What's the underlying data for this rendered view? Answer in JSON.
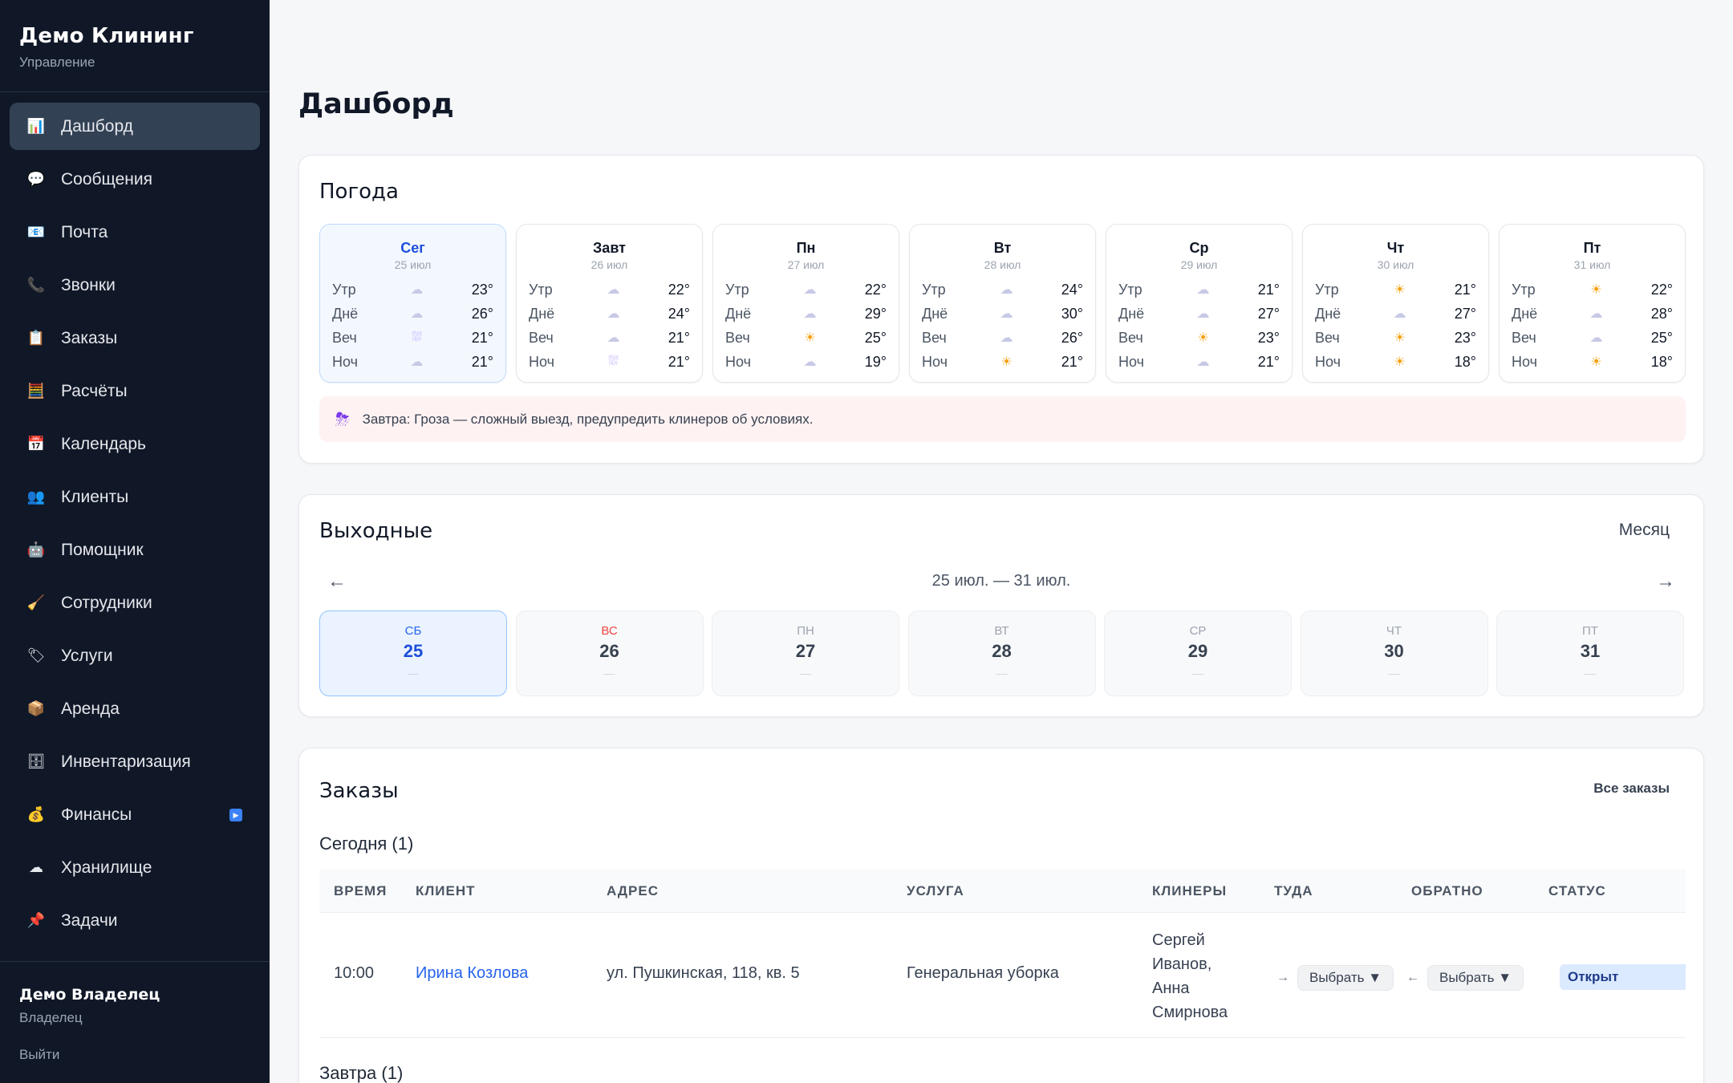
{
  "brand": {
    "title": "Демо Клининг",
    "subtitle": "Управление"
  },
  "nav": [
    {
      "label": "Дашборд",
      "icon": "📊",
      "active": true
    },
    {
      "label": "Сообщения",
      "icon": "💬"
    },
    {
      "label": "Почта",
      "icon": "📧"
    },
    {
      "label": "Звонки",
      "icon": "📞"
    },
    {
      "label": "Заказы",
      "icon": "📋"
    },
    {
      "label": "Расчёты",
      "icon": "🧮"
    },
    {
      "label": "Календарь",
      "icon": "📅"
    },
    {
      "label": "Клиенты",
      "icon": "👥"
    },
    {
      "label": "Помощник",
      "icon": "🤖"
    },
    {
      "label": "Сотрудники",
      "icon": "🧹"
    },
    {
      "label": "Услуги",
      "icon": "🏷"
    },
    {
      "label": "Аренда",
      "icon": "📦"
    },
    {
      "label": "Инвентаризация",
      "icon": "🗄"
    },
    {
      "label": "Финансы",
      "icon": "💰",
      "badge": "▶"
    },
    {
      "label": "Хранилище",
      "icon": "☁"
    },
    {
      "label": "Задачи",
      "icon": "📌"
    }
  ],
  "user": {
    "name": "Демо Владелец",
    "role": "Владелец",
    "logout": "Выйти"
  },
  "page": {
    "title": "Дашборд"
  },
  "weather": {
    "title": "Погода",
    "days": [
      {
        "name": "Сег",
        "date": "25 июл",
        "rows": [
          [
            "Утр",
            "cloud",
            "23°"
          ],
          [
            "Днё",
            "cloud",
            "26°"
          ],
          [
            "Веч",
            "rain",
            "21°"
          ],
          [
            "Ноч",
            "cloud",
            "21°"
          ]
        ]
      },
      {
        "name": "Завт",
        "date": "26 июл",
        "rows": [
          [
            "Утр",
            "cloud",
            "22°"
          ],
          [
            "Днё",
            "cloud",
            "24°"
          ],
          [
            "Веч",
            "cloud",
            "21°"
          ],
          [
            "Ноч",
            "rain",
            "21°"
          ]
        ]
      },
      {
        "name": "Пн",
        "date": "27 июл",
        "rows": [
          [
            "Утр",
            "cloud",
            "22°"
          ],
          [
            "Днё",
            "cloud",
            "29°"
          ],
          [
            "Веч",
            "sun",
            "25°"
          ],
          [
            "Ноч",
            "cloud",
            "19°"
          ]
        ]
      },
      {
        "name": "Вт",
        "date": "28 июл",
        "rows": [
          [
            "Утр",
            "cloud",
            "24°"
          ],
          [
            "Днё",
            "cloud",
            "30°"
          ],
          [
            "Веч",
            "cloud",
            "26°"
          ],
          [
            "Ноч",
            "sun",
            "21°"
          ]
        ]
      },
      {
        "name": "Ср",
        "date": "29 июл",
        "rows": [
          [
            "Утр",
            "cloud",
            "21°"
          ],
          [
            "Днё",
            "cloud",
            "27°"
          ],
          [
            "Веч",
            "sun",
            "23°"
          ],
          [
            "Ноч",
            "cloud",
            "21°"
          ]
        ]
      },
      {
        "name": "Чт",
        "date": "30 июл",
        "rows": [
          [
            "Утр",
            "sun",
            "21°"
          ],
          [
            "Днё",
            "cloud",
            "27°"
          ],
          [
            "Веч",
            "sun",
            "23°"
          ],
          [
            "Ноч",
            "sun",
            "18°"
          ]
        ]
      },
      {
        "name": "Пт",
        "date": "31 июл",
        "rows": [
          [
            "Утр",
            "sun",
            "22°"
          ],
          [
            "Днё",
            "cloud",
            "28°"
          ],
          [
            "Веч",
            "cloud",
            "25°"
          ],
          [
            "Ноч",
            "sun",
            "18°"
          ]
        ]
      }
    ],
    "alert": "Завтра: Гроза — сложный выезд, предупредить клинеров об условиях."
  },
  "weekends": {
    "title": "Выходные",
    "month_link": "Месяц",
    "range": "25 июл. — 31 июл.",
    "prev": "←",
    "next": "→",
    "days": [
      {
        "name": "СБ",
        "num": "25",
        "mark": "—"
      },
      {
        "name": "ВС",
        "num": "26",
        "mark": "—"
      },
      {
        "name": "ПН",
        "num": "27",
        "mark": "—"
      },
      {
        "name": "ВТ",
        "num": "28",
        "mark": "—"
      },
      {
        "name": "СР",
        "num": "29",
        "mark": "—"
      },
      {
        "name": "ЧТ",
        "num": "30",
        "mark": "—"
      },
      {
        "name": "ПТ",
        "num": "31",
        "mark": "—"
      }
    ]
  },
  "orders": {
    "title": "Заказы",
    "all_link": "Все заказы",
    "today_header": "Сегодня (1)",
    "tomorrow_header": "Завтра (1)",
    "columns": [
      "ВРЕМЯ",
      "КЛИЕНТ",
      "АДРЕС",
      "УСЛУГА",
      "КЛИНЕРЫ",
      "ТУДА",
      "ОБРАТНО",
      "СТАТУС"
    ],
    "rows": [
      {
        "time": "10:00",
        "client": "Ирина Козлова",
        "address": "ул. Пушкинская, 118, кв. 5",
        "service": "Генеральная уборка",
        "cleaners": [
          "Сергей",
          "Иванов,",
          "Анна",
          "Смирнова"
        ],
        "to_arrow": "→",
        "to_select": "Выбрать ▼",
        "back_arrow": "←",
        "back_select": "Выбрать ▼",
        "status": "Открыт"
      }
    ]
  }
}
